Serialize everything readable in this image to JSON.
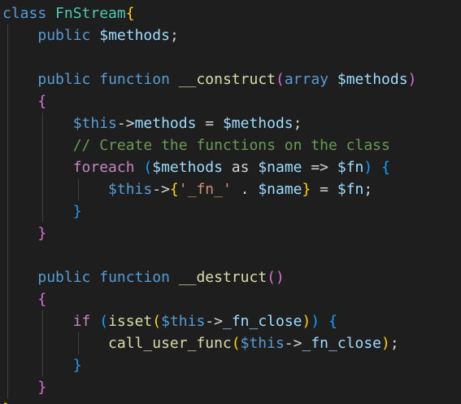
{
  "editor": {
    "language": "php",
    "theme": "dark",
    "colors": {
      "background": "#1e1e1e",
      "default": "#d4d4d4",
      "keyword": "#569cd6",
      "control": "#c586c0",
      "variable": "#9cdcfe",
      "function": "#dcdcaa",
      "class": "#4ec9b0",
      "string": "#ce9178",
      "comment": "#6a9955",
      "bracket_1": "#ffd700",
      "bracket_2": "#da70d6",
      "bracket_3": "#179fff",
      "indent_guide": "#404040"
    },
    "lines": [
      [
        {
          "t": "class",
          "c": "kw"
        },
        {
          "t": " ",
          "c": "p"
        },
        {
          "t": "FnStream",
          "c": "cls"
        },
        {
          "t": "{",
          "c": "b1"
        }
      ],
      [
        {
          "t": "    ",
          "c": "p"
        },
        {
          "t": "public",
          "c": "kw"
        },
        {
          "t": " ",
          "c": "p"
        },
        {
          "t": "$methods",
          "c": "var"
        },
        {
          "t": ";",
          "c": "p"
        }
      ],
      [
        {
          "t": "",
          "c": "p"
        }
      ],
      [
        {
          "t": "    ",
          "c": "p"
        },
        {
          "t": "public",
          "c": "kw"
        },
        {
          "t": " ",
          "c": "p"
        },
        {
          "t": "function",
          "c": "kw"
        },
        {
          "t": " ",
          "c": "p"
        },
        {
          "t": "__construct",
          "c": "fn"
        },
        {
          "t": "(",
          "c": "b2"
        },
        {
          "t": "array",
          "c": "kw"
        },
        {
          "t": " ",
          "c": "p"
        },
        {
          "t": "$methods",
          "c": "var"
        },
        {
          "t": ")",
          "c": "b2"
        }
      ],
      [
        {
          "t": "    ",
          "c": "p"
        },
        {
          "t": "{",
          "c": "b2"
        }
      ],
      [
        {
          "t": "        ",
          "c": "p"
        },
        {
          "t": "$this",
          "c": "this"
        },
        {
          "t": "->",
          "c": "p"
        },
        {
          "t": "methods",
          "c": "var"
        },
        {
          "t": " = ",
          "c": "p"
        },
        {
          "t": "$methods",
          "c": "var"
        },
        {
          "t": ";",
          "c": "p"
        }
      ],
      [
        {
          "t": "        ",
          "c": "p"
        },
        {
          "t": "// Create the functions on the class",
          "c": "com"
        }
      ],
      [
        {
          "t": "        ",
          "c": "p"
        },
        {
          "t": "foreach",
          "c": "ctl"
        },
        {
          "t": " ",
          "c": "p"
        },
        {
          "t": "(",
          "c": "b3"
        },
        {
          "t": "$methods",
          "c": "var"
        },
        {
          "t": " as ",
          "c": "p"
        },
        {
          "t": "$name",
          "c": "var"
        },
        {
          "t": " => ",
          "c": "p"
        },
        {
          "t": "$fn",
          "c": "var"
        },
        {
          "t": ")",
          "c": "b3"
        },
        {
          "t": " ",
          "c": "p"
        },
        {
          "t": "{",
          "c": "b3"
        }
      ],
      [
        {
          "t": "            ",
          "c": "p"
        },
        {
          "t": "$this",
          "c": "this"
        },
        {
          "t": "->",
          "c": "p"
        },
        {
          "t": "{",
          "c": "b1"
        },
        {
          "t": "'_fn_'",
          "c": "str"
        },
        {
          "t": " . ",
          "c": "p"
        },
        {
          "t": "$name",
          "c": "var"
        },
        {
          "t": "}",
          "c": "b1"
        },
        {
          "t": " = ",
          "c": "p"
        },
        {
          "t": "$fn",
          "c": "var"
        },
        {
          "t": ";",
          "c": "p"
        }
      ],
      [
        {
          "t": "        ",
          "c": "p"
        },
        {
          "t": "}",
          "c": "b3"
        }
      ],
      [
        {
          "t": "    ",
          "c": "p"
        },
        {
          "t": "}",
          "c": "b2"
        }
      ],
      [
        {
          "t": "",
          "c": "p"
        }
      ],
      [
        {
          "t": "    ",
          "c": "p"
        },
        {
          "t": "public",
          "c": "kw"
        },
        {
          "t": " ",
          "c": "p"
        },
        {
          "t": "function",
          "c": "kw"
        },
        {
          "t": " ",
          "c": "p"
        },
        {
          "t": "__destruct",
          "c": "fn"
        },
        {
          "t": "()",
          "c": "b2"
        }
      ],
      [
        {
          "t": "    ",
          "c": "p"
        },
        {
          "t": "{",
          "c": "b2"
        }
      ],
      [
        {
          "t": "        ",
          "c": "p"
        },
        {
          "t": "if",
          "c": "ctl"
        },
        {
          "t": " ",
          "c": "p"
        },
        {
          "t": "(",
          "c": "b3"
        },
        {
          "t": "isset",
          "c": "fn"
        },
        {
          "t": "(",
          "c": "b1"
        },
        {
          "t": "$this",
          "c": "this"
        },
        {
          "t": "->",
          "c": "p"
        },
        {
          "t": "_fn_close",
          "c": "var"
        },
        {
          "t": ")",
          "c": "b1"
        },
        {
          "t": ")",
          "c": "b3"
        },
        {
          "t": " ",
          "c": "p"
        },
        {
          "t": "{",
          "c": "b3"
        }
      ],
      [
        {
          "t": "            ",
          "c": "p"
        },
        {
          "t": "call_user_func",
          "c": "fn"
        },
        {
          "t": "(",
          "c": "b1"
        },
        {
          "t": "$this",
          "c": "this"
        },
        {
          "t": "->",
          "c": "p"
        },
        {
          "t": "_fn_close",
          "c": "var"
        },
        {
          "t": ")",
          "c": "b1"
        },
        {
          "t": ";",
          "c": "p"
        }
      ],
      [
        {
          "t": "        ",
          "c": "p"
        },
        {
          "t": "}",
          "c": "b3"
        }
      ],
      [
        {
          "t": "    ",
          "c": "p"
        },
        {
          "t": "}",
          "c": "b2"
        }
      ],
      [
        {
          "t": "}",
          "c": "b1"
        }
      ]
    ]
  }
}
